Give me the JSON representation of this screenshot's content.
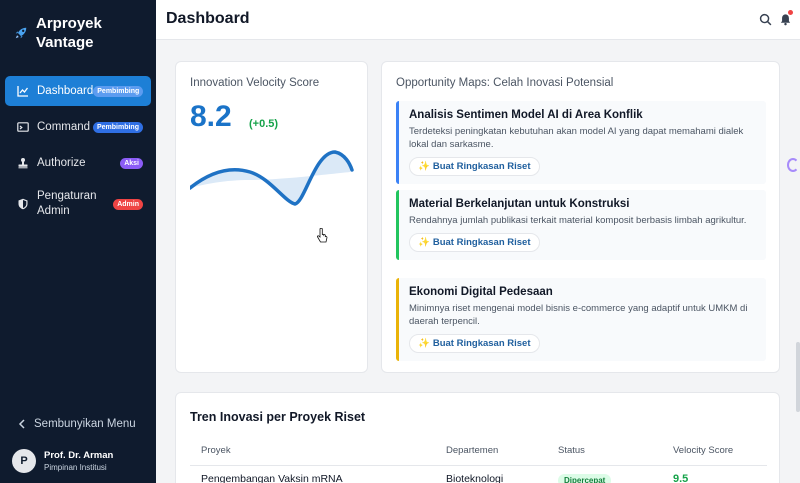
{
  "app": {
    "name": "Arproyek Vantage"
  },
  "sidebar": {
    "items": [
      {
        "label": "Dashboard",
        "badge": "Pembimbing",
        "icon": "chart-line-icon"
      },
      {
        "label": "Command",
        "badge": "Pembimbing",
        "icon": "terminal-icon"
      },
      {
        "label": "Authorize",
        "badge": "Aksi",
        "icon": "stamp-icon"
      },
      {
        "label": "Pengaturan Admin",
        "badge": "Admin",
        "icon": "shield-icon"
      }
    ],
    "collapse_label": "Sembunyikan Menu",
    "user": {
      "initial": "P",
      "name": "Prof. Dr. Arman",
      "role": "Pimpinan Institusi"
    }
  },
  "header": {
    "title": "Dashboard"
  },
  "velocity": {
    "label": "Innovation Velocity Score",
    "value": "8.2",
    "delta": "(+0.5)"
  },
  "opportunities": {
    "title": "Opportunity Maps: Celah Inovasi Potensial",
    "button_label": "Buat Ringkasan Riset",
    "items": [
      {
        "title": "Analisis Sentimen Model AI di Area Konflik",
        "desc": "Terdeteksi peningkatan kebutuhan akan model AI yang dapat memahami dialek lokal dan sarkasme.",
        "accent": "#3b82f6"
      },
      {
        "title": "Material Berkelanjutan untuk Konstruksi",
        "desc": "Rendahnya jumlah publikasi terkait material komposit berbasis limbah agrikultur.",
        "accent": "#22c55e"
      },
      {
        "title": "Ekonomi Digital Pedesaan",
        "desc": "Minimnya riset mengenai model bisnis e-commerce yang adaptif untuk UMKM di daerah terpencil.",
        "accent": "#eab308"
      }
    ]
  },
  "trend": {
    "title": "Tren Inovasi per Proyek Riset",
    "columns": [
      "Proyek",
      "Departemen",
      "Status",
      "Velocity Score"
    ],
    "rows": [
      {
        "project": "Pengembangan Vaksin mRNA",
        "department": "Bioteknologi",
        "status": "Dipercepat",
        "score": "9.5"
      }
    ]
  },
  "colors": {
    "sidebar": "#0f1b2e",
    "accent": "#1d7fd6",
    "score": "#1a73c8",
    "positive": "#16a34a"
  }
}
